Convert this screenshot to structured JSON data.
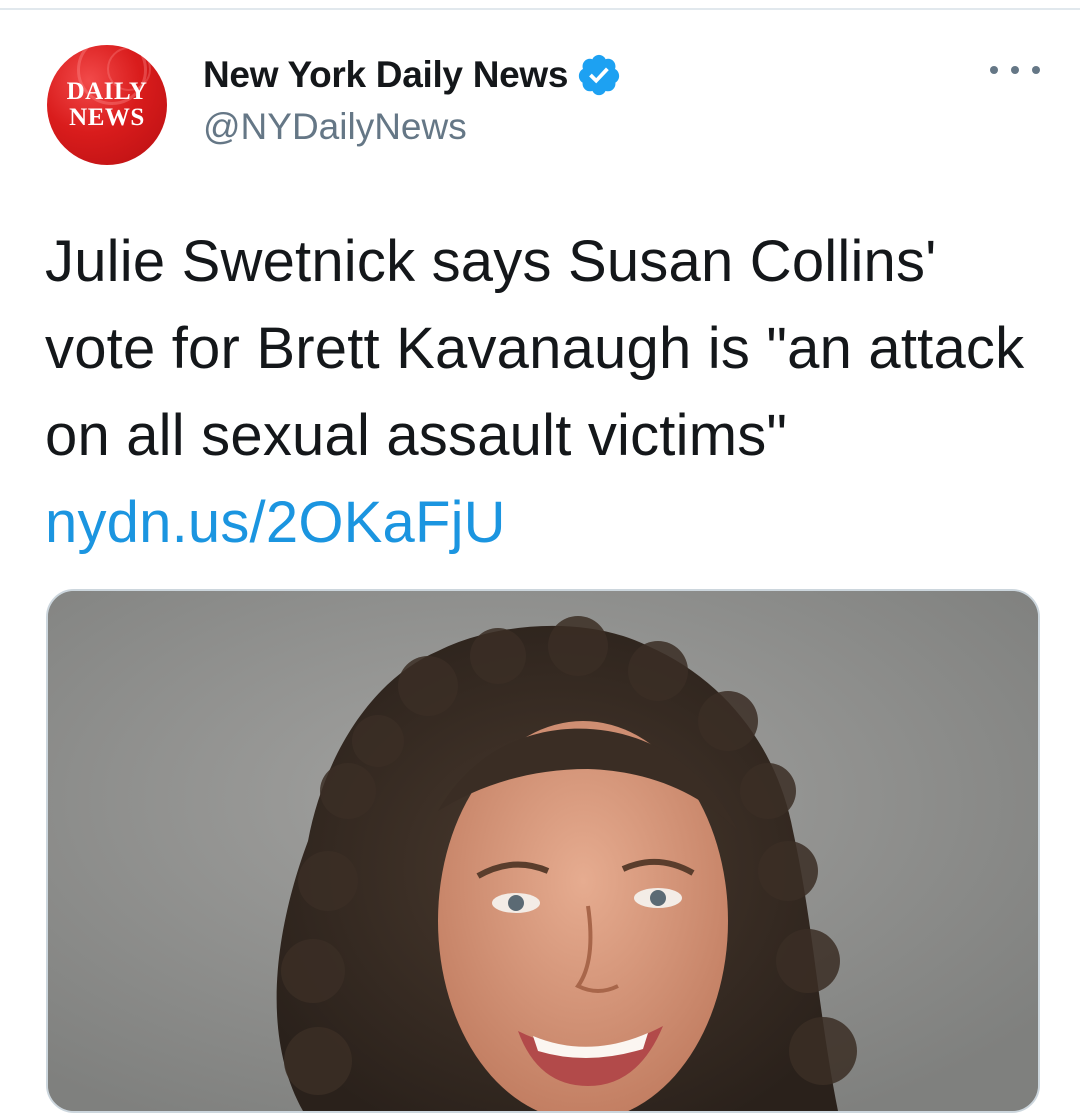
{
  "tweet": {
    "author": {
      "display_name": "New York Daily News",
      "handle": "@NYDailyNews",
      "verified": true,
      "avatar": {
        "line1": "DAILY",
        "line2": "NEWS",
        "color": "#d91c1c"
      }
    },
    "text": "Julie Swetnick says Susan Collins' vote for Brett Kavanaugh is \"an attack on all sexual assault victims\" ",
    "link": "nydn.us/2OKaFjU",
    "more_icon": "more-horizontal-icon",
    "verified_icon": "verified-badge-icon"
  },
  "colors": {
    "text": "#14171a",
    "secondary": "#657786",
    "link": "#1b95e0",
    "verified": "#1da1f2"
  }
}
